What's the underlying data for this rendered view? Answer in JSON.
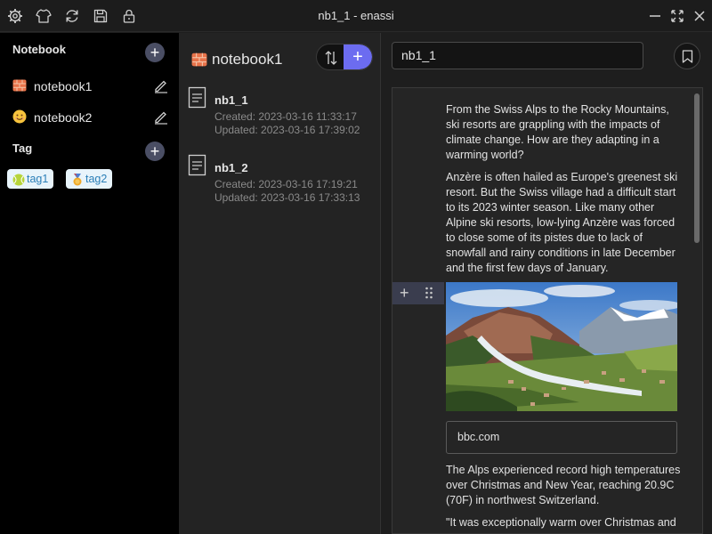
{
  "window": {
    "title": "nb1_1 - enassi",
    "toolbar_icons": [
      "gear-icon",
      "tshirt-icon",
      "refresh-icon",
      "save-icon",
      "lock-icon"
    ],
    "controls": [
      "minimize-icon",
      "fullscreen-icon",
      "close-icon"
    ]
  },
  "sidebar": {
    "notebook_header": "Notebook",
    "notebooks": [
      {
        "label": "notebook1",
        "icon": "brick-icon"
      },
      {
        "label": "notebook2",
        "icon": "smiley-icon"
      }
    ],
    "tag_header": "Tag",
    "tags": [
      {
        "label": "tag1",
        "icon": "tennis-ball-icon"
      },
      {
        "label": "tag2",
        "icon": "medal-icon"
      }
    ]
  },
  "notelist": {
    "title": "notebook1",
    "notes": [
      {
        "title": "nb1_1",
        "created": "Created: 2023-03-16 11:33:17",
        "updated": "Updated: 2023-03-16 17:39:02"
      },
      {
        "title": "nb1_2",
        "created": "Created: 2023-03-16 17:19:21",
        "updated": "Updated: 2023-03-16 17:33:13"
      }
    ]
  },
  "editor": {
    "note_title": "nb1_1",
    "paragraphs": [
      "From the Swiss Alps to the Rocky Mountains, ski resorts are grappling with the impacts of climate change. How are they adapting in a warming world?",
      "Anzère is often hailed as Europe's greenest ski resort. But the Swiss village had a difficult start to its 2023 winter season. Like many other Alpine ski resorts, low-lying Anzère was forced to close some of its pistes due to lack of snowfall and rainy conditions in late December and the first few days of January.",
      "The Alps experienced record high temperatures over Christmas and New Year, reaching 20.9C (70F) in northwest Switzerland.",
      "\"It was exceptionally warm over Christmas and"
    ],
    "link_caption": "bbc.com"
  },
  "colors": {
    "accent": "#6c6cf0",
    "tag_bg": "#e8f4fb",
    "tag_text": "#2a7fb8"
  }
}
